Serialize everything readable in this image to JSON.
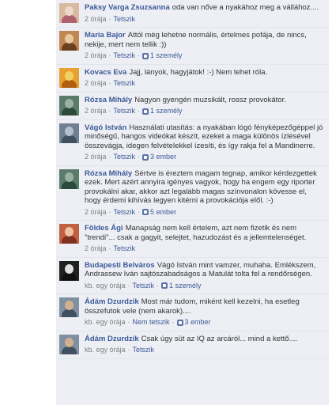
{
  "comments": [
    {
      "author": "Paksy Varga Zsuzsanna",
      "text": "oda van nőve a nyakához meg a vállához....",
      "time": "2 órája",
      "like_label": "Tetszik",
      "likes": "",
      "avatar_colors": [
        "#d9b9a0",
        "#b06070",
        "#f0d8c8"
      ]
    },
    {
      "author": "Maria Bajor",
      "text": "Attól még lehetne normális, értelmes pofája, de nincs, nekije, mert nem tellik :))",
      "time": "2 órája",
      "like_label": "Tetszik",
      "likes": "1 személy",
      "avatar_colors": [
        "#c08850",
        "#6a4020",
        "#e8c8a0"
      ]
    },
    {
      "author": "Kovacs Eva",
      "text": "Jajj, lányok, hagyjátok! :-) Nem tehet róla.",
      "time": "2 órája",
      "like_label": "Tetszik",
      "likes": "",
      "avatar_colors": [
        "#e8a030",
        "#b06010",
        "#f0d060"
      ]
    },
    {
      "author": "Rózsa Mihály",
      "text": "Nagyon gyengén muzsikált, rossz provokátor.",
      "time": "2 órája",
      "like_label": "Tetszik",
      "likes": "1 személy",
      "avatar_colors": [
        "#5a7a6a",
        "#2a4a3a",
        "#9ab0a0"
      ]
    },
    {
      "author": "Vágó István",
      "text": "Használati utasítás: a nyakában lógó fényképezőgéppel jó minőségű, hangos videókat készít, ezeket a maga különös ízlésével összevágja, idegen felvételekkel ízesíti, és így rakja fel a Mandinerre.",
      "time": "2 órája",
      "like_label": "Tetszik",
      "likes": "3 ember",
      "avatar_colors": [
        "#708090",
        "#405060",
        "#b0c0d0"
      ]
    },
    {
      "author": "Rózsa Mihály",
      "text": "Sértve is éreztem magam tegnap, amikor kérdezgettek ezek. Mert azért annyira igényes vagyok, hogy ha engem egy riporter provokálni akar, akkor azt legalább magas színvonalon kövesse el, hogy érdemi kihívás legyen kitérni a provokációja elől. :-)",
      "time": "2 órája",
      "like_label": "Tetszik",
      "likes": "5 ember",
      "avatar_colors": [
        "#5a7a6a",
        "#2a4a3a",
        "#9ab0a0"
      ]
    },
    {
      "author": "Földes Ági",
      "text": "Manapság nem kell értelem, azt nem fizetik és nem \"trendi\"... csak a gagyit, selejtet, hazudozást és a jellemtelenséget.",
      "time": "2 órája",
      "like_label": "Tetszik",
      "likes": "",
      "avatar_colors": [
        "#c06040",
        "#803020",
        "#f0c0a0"
      ]
    },
    {
      "author": "Budapesti Belváros",
      "text": "Vágó István mint vamzer, muhaha. Emlékszem, Andrassew Iván sajtószabadságos a Matulát tolta fel a rendőrségen.",
      "time": "kb. egy órája",
      "like_label": "Tetszik",
      "likes": "1 személy",
      "avatar_colors": [
        "#202020",
        "#101010",
        "#e0e0e0"
      ]
    },
    {
      "author": "Ádám Dzurdzik",
      "text": "Most már tudom, miként kell kezelni, ha esetleg összefutok vele (nem akarok)....",
      "time": "kb. egy órája",
      "like_label": "Nem tetszik",
      "likes": "3 ember",
      "avatar_colors": [
        "#8090a0",
        "#405060",
        "#d0b090"
      ]
    },
    {
      "author": "Ádám Dzurdzik",
      "text": "Csak úgy süt az IQ az arcáról... mind a kettő....",
      "time": "kb. egy órája",
      "like_label": "Tetszik",
      "likes": "",
      "avatar_colors": [
        "#8090a0",
        "#405060",
        "#d0b090"
      ]
    }
  ]
}
